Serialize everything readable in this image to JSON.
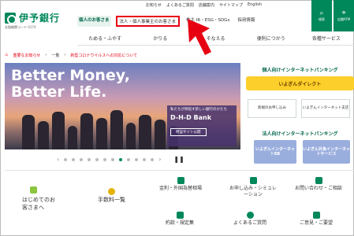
{
  "header": {
    "logo": "伊予銀行",
    "logo_sub": "金融機関コード 0174",
    "topbar": [
      "お知らせ",
      "よくあるご質問",
      "店舗案内",
      "サイトマップ",
      "English"
    ],
    "nav_tabs": [
      "個人のお客さま",
      "法人・個人事業主のお客さま",
      "株主 IR・ESG・SDGs",
      "採用情報"
    ],
    "icon_buttons": [
      {
        "glyph": "⌕",
        "label": "検索"
      },
      {
        "glyph": "⌖",
        "label": "店舗ATM"
      }
    ]
  },
  "mainnav": [
    "ためる・ふやす",
    "かりる",
    "そなえる",
    "便利につかう",
    "各種サービス"
  ],
  "notice": {
    "label": "重要なお知らせ",
    "link1": "一覧",
    "link2": "新型コロナウイルスへの対応について"
  },
  "hero": {
    "title_line1": "Better Money,",
    "title_line2": "Better Life.",
    "card_small": "私たちが目指す新しい銀行のかたち",
    "card_big": "D-H-D Bank",
    "card_button": "特設サイト公開"
  },
  "right": {
    "personal_head": "個人向けインターネットバンキング",
    "direct": "いよぎんダイレクト",
    "box1": "新規のお申し込み",
    "box2": "いよぎんインターネット支店",
    "corp_head": "法人向けインターネットバンキング",
    "biz1": "いよぎんインターネットEB",
    "biz2": "いよぎん外為インターネットサービス"
  },
  "bottom": {
    "beginners": "はじめてのお客さまへ",
    "fees": "手数料一覧",
    "rates": "金利・外国為替相場",
    "apply": "お申し込み・シミュレーション",
    "contact": "お問い合わせ・ご相談",
    "terms": "約款・規定集",
    "faq": "よくあるご質問",
    "opinion": "ご意見・ご要望"
  },
  "colors": {
    "brand": "#00875a",
    "highlight": "#e60012",
    "direct": "#fccf2a"
  }
}
